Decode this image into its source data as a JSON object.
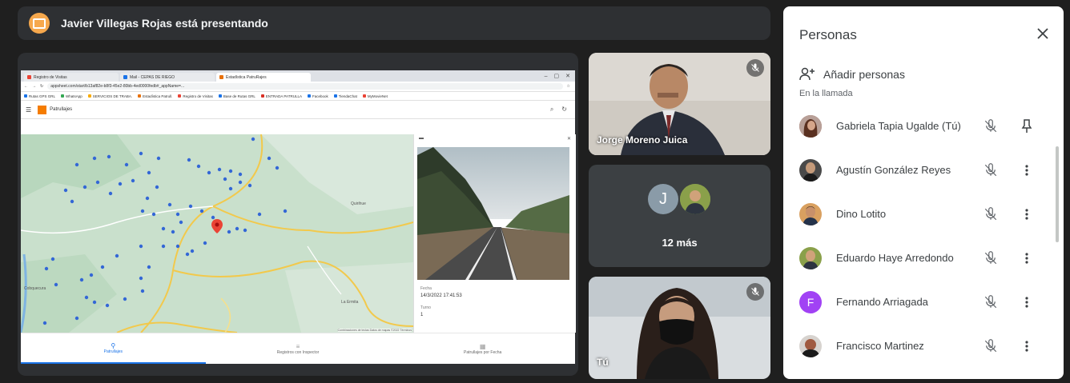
{
  "banner": {
    "presenting_text": "Javier Villegas Rojas está presentando"
  },
  "browser": {
    "tabs": [
      {
        "label": "Registro de Visitas"
      },
      {
        "label": "Mail - CEPAS DE RIEGO"
      },
      {
        "label": "Estadística PatruRajes"
      }
    ],
    "url": "appsheet.com/start/b13af82e-b8f3-45e2-80bb-4ed0000fedb#_appName=...",
    "bookmarks": [
      "Rutas GPS GRL",
      "WhatsApp",
      "SERVICIOS DE TRABA.",
      "Estadística Patrull.",
      "Registro de Visitas",
      "Base de Rutas GRL",
      "ENTRADA PATRULLA",
      "Facebook",
      "TiendaChat",
      "MyMovieNet"
    ],
    "app_title": "Patrullajes",
    "sidepanel": {
      "date_label": "Fecha",
      "date_value": "14/3/2022 17:41:53",
      "count_label": "Turno",
      "count_value": "1"
    },
    "map_labels": [
      "Quirihue",
      "La Ermita",
      "Cobquecura"
    ],
    "map_credits": "Combinaciones de teclas  Datos de mapas ©2022  Términos",
    "nav": [
      {
        "label": "Patrullajes",
        "icon": "pin-icon"
      },
      {
        "label": "Registros con Inspector",
        "icon": "list-icon"
      },
      {
        "label": "Patrullajes por Fecha",
        "icon": "calendar-icon"
      }
    ]
  },
  "tiles": {
    "speaker_name": "Jorge Moreno Juica",
    "more_count": "12 más",
    "more_avatar_letter": "J",
    "self_label": "Tú"
  },
  "people_panel": {
    "title": "Personas",
    "add_people": "Añadir personas",
    "in_call": "En la llamada",
    "participants": [
      {
        "name": "Gabriela Tapia Ugalde (Tú)",
        "avatar_color": "#a06050",
        "letter": "",
        "action": "pin-icon"
      },
      {
        "name": "Agustín González Reyes",
        "avatar_color": "#3a3a3a",
        "letter": "",
        "action": "more-vert-icon"
      },
      {
        "name": "Dino Lotito",
        "avatar_color": "#b07040",
        "letter": "",
        "action": "more-vert-icon"
      },
      {
        "name": "Eduardo Haye Arredondo",
        "avatar_color": "#8a9a3a",
        "letter": "",
        "action": "more-vert-icon"
      },
      {
        "name": "Fernando Arriagada",
        "avatar_color": "#a142f4",
        "letter": "F",
        "action": "more-vert-icon"
      },
      {
        "name": "Francisco Martinez",
        "avatar_color": "#8a4a3a",
        "letter": "",
        "action": "more-vert-icon"
      }
    ]
  },
  "colors": {
    "presenter_badge": "#f6a84d",
    "map_pin": "#ea4335",
    "map_point": "#3367d6"
  }
}
